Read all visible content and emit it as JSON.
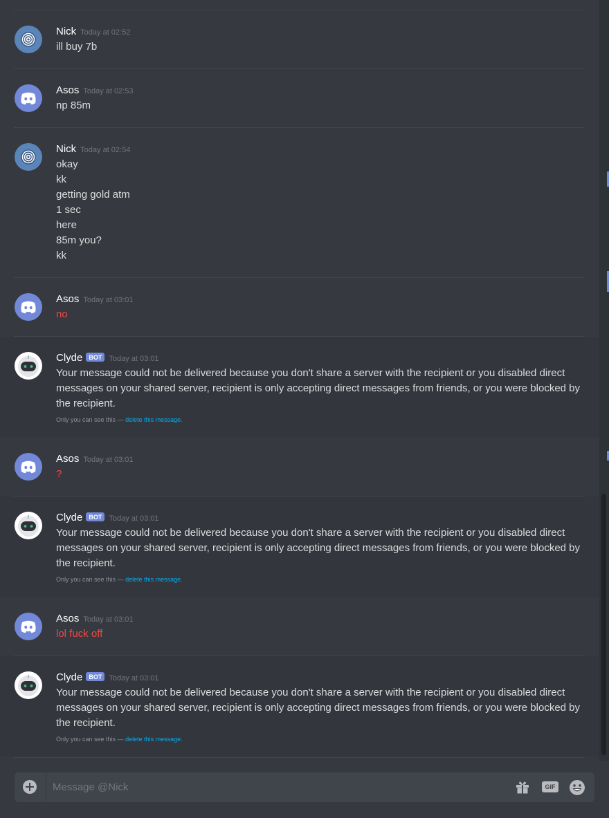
{
  "messages": [
    {
      "author": "Nick",
      "time": "Today at 02:52",
      "lines": [
        "ill buy 7b"
      ]
    },
    {
      "author": "Asos",
      "time": "Today at 02:53",
      "lines": [
        "np 85m"
      ]
    },
    {
      "author": "Nick",
      "time": "Today at 02:54",
      "lines": [
        "okay",
        "kk",
        "getting gold atm",
        "1 sec",
        "here",
        "85m you?",
        "kk"
      ]
    },
    {
      "author": "Asos",
      "time": "Today at 03:01",
      "lines": [
        "no"
      ]
    },
    {
      "author": "Clyde",
      "tag": "BOT",
      "time": "Today at 03:01",
      "text": "Your message could not be delivered because you don't share a server with the recipient or you disabled direct messages on your shared server, recipient is only accepting direct messages from friends, or you were blocked by the recipient.",
      "ephemeral": "Only you can see this —",
      "delete_link": "delete this message."
    },
    {
      "author": "Asos",
      "time": "Today at 03:01",
      "lines": [
        "?"
      ]
    },
    {
      "author": "Clyde",
      "tag": "BOT",
      "time": "Today at 03:01",
      "text": "Your message could not be delivered because you don't share a server with the recipient or you disabled direct messages on your shared server, recipient is only accepting direct messages from friends, or you were blocked by the recipient.",
      "ephemeral": "Only you can see this —",
      "delete_link": "delete this message."
    },
    {
      "author": "Asos",
      "time": "Today at 03:01",
      "lines": [
        "lol fuck off"
      ]
    },
    {
      "author": "Clyde",
      "tag": "BOT",
      "time": "Today at 03:01",
      "text": "Your message could not be delivered because you don't share a server with the recipient or you disabled direct messages on your shared server, recipient is only accepting direct messages from friends, or you were blocked by the recipient.",
      "ephemeral": "Only you can see this —",
      "delete_link": "delete this message."
    }
  ],
  "composer": {
    "placeholder": "Message @Nick",
    "gif_label": "GIF",
    "icons": [
      "plus-circle-icon",
      "gift-icon",
      "gif-icon",
      "emoji-icon"
    ]
  },
  "colors": {
    "background": "#36393f",
    "blurple": "#7289da",
    "failed_text": "#f04747",
    "link": "#00b0f4"
  }
}
